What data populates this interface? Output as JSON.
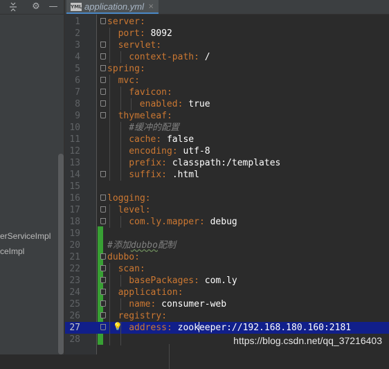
{
  "left_panel": {
    "toolbar_icons": [
      "collapse-all-icon",
      "gear-icon",
      "minimize-icon"
    ],
    "items": [
      "erServiceImpl",
      "ceImpl"
    ]
  },
  "tabs": [
    {
      "label": "application.yml",
      "icon": "yml-file-icon",
      "icon_text": "YML",
      "close": "×"
    }
  ],
  "editor": {
    "lines": [
      {
        "num": "1",
        "indent": 0,
        "key": "server",
        "value": "",
        "comment": ""
      },
      {
        "num": "2",
        "indent": 1,
        "key": "port",
        "value": "8092",
        "comment": ""
      },
      {
        "num": "3",
        "indent": 1,
        "key": "servlet",
        "value": "",
        "comment": ""
      },
      {
        "num": "4",
        "indent": 2,
        "key": "context-path",
        "value": "/",
        "comment": ""
      },
      {
        "num": "5",
        "indent": 0,
        "key": "spring",
        "value": "",
        "comment": ""
      },
      {
        "num": "6",
        "indent": 1,
        "key": "mvc",
        "value": "",
        "comment": ""
      },
      {
        "num": "7",
        "indent": 2,
        "key": "favicon",
        "value": "",
        "comment": ""
      },
      {
        "num": "8",
        "indent": 3,
        "key": "enabled",
        "value": "true",
        "comment": ""
      },
      {
        "num": "9",
        "indent": 1,
        "key": "thymeleaf",
        "value": "",
        "comment": ""
      },
      {
        "num": "10",
        "indent": 2,
        "key": "",
        "value": "",
        "comment": "#缓冲的配置"
      },
      {
        "num": "11",
        "indent": 2,
        "key": "cache",
        "value": "false",
        "comment": ""
      },
      {
        "num": "12",
        "indent": 2,
        "key": "encoding",
        "value": "utf-8",
        "comment": ""
      },
      {
        "num": "13",
        "indent": 2,
        "key": "prefix",
        "value": "classpath:/templates",
        "comment": ""
      },
      {
        "num": "14",
        "indent": 2,
        "key": "suffix",
        "value": ".html",
        "comment": ""
      },
      {
        "num": "15",
        "indent": 0,
        "key": "",
        "value": "",
        "comment": ""
      },
      {
        "num": "16",
        "indent": 0,
        "key": "logging",
        "value": "",
        "comment": ""
      },
      {
        "num": "17",
        "indent": 1,
        "key": "level",
        "value": "",
        "comment": ""
      },
      {
        "num": "18",
        "indent": 2,
        "key": "com.ly.mapper",
        "value": "debug",
        "comment": ""
      },
      {
        "num": "19",
        "indent": 0,
        "key": "",
        "value": "",
        "comment": ""
      },
      {
        "num": "20",
        "indent": 0,
        "key": "",
        "value": "",
        "comment": "#添加dubbo配制"
      },
      {
        "num": "21",
        "indent": 0,
        "key": "dubbo",
        "value": "",
        "comment": ""
      },
      {
        "num": "22",
        "indent": 1,
        "key": "scan",
        "value": "",
        "comment": ""
      },
      {
        "num": "23",
        "indent": 2,
        "key": "basePackages",
        "value": "com.ly",
        "comment": ""
      },
      {
        "num": "24",
        "indent": 1,
        "key": "application",
        "value": "",
        "comment": ""
      },
      {
        "num": "25",
        "indent": 2,
        "key": "name",
        "value": "consumer-web",
        "comment": ""
      },
      {
        "num": "26",
        "indent": 1,
        "key": "registry",
        "value": "",
        "comment": ""
      },
      {
        "num": "27",
        "indent": 2,
        "key": "address",
        "value": "zookeeper://192.168.180.160:2181",
        "comment": "",
        "current": true
      },
      {
        "num": "28",
        "indent": 2,
        "key": "",
        "value": "",
        "comment": ""
      }
    ]
  },
  "watermark": "https://blog.csdn.net/qq_37216403",
  "colors": {
    "key": "#cc7832",
    "value": "#ffffff",
    "comment": "#808080",
    "current_line": "#111f8a",
    "vcs_added": "#38a034"
  }
}
